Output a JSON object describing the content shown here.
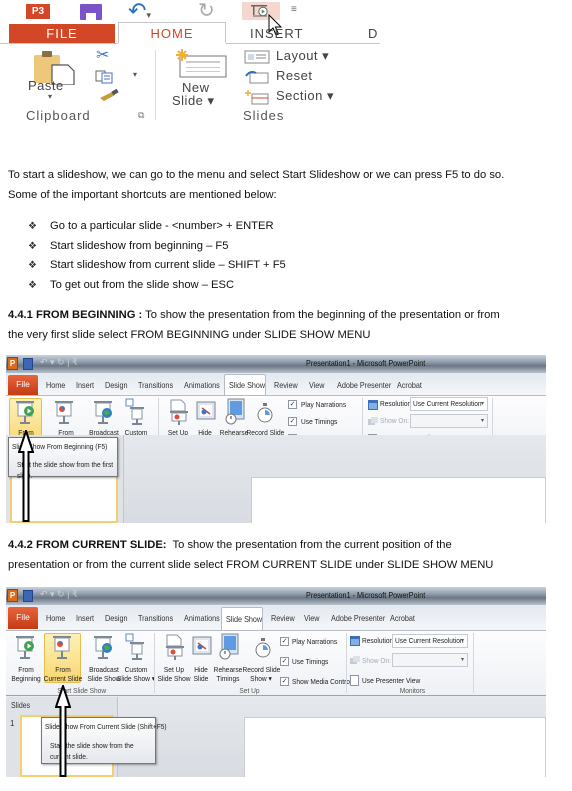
{
  "ribbon2013": {
    "qat": {
      "app_icon": "P3",
      "save_icon": "save-icon",
      "undo_icon": "undo-icon",
      "redo_icon": "redo-icon",
      "start_icon": "start-from-beginning-icon",
      "dropdown": "▾",
      "customize": "₹"
    },
    "tabs": [
      "FILE",
      "HOME",
      "INSERT",
      "D"
    ],
    "clipboard": {
      "paste": "Paste",
      "paste_arrow": "▾",
      "group": "Clipboard",
      "launcher": "⧉"
    },
    "slides": {
      "new_slide_1": "New",
      "new_slide_2": "Slide ▾",
      "layout": "Layout ▾",
      "reset": "Reset",
      "section": "Section ▾",
      "group": "Slides"
    }
  },
  "text": {
    "intro_1": "To start a slideshow, we can go to the menu and select Start Slideshow or we can press F5 to do so.",
    "intro_2": "Some of the important shortcuts are mentioned below:",
    "bullet_glyph": "❖",
    "bullets": [
      "Go to a particular slide - <number> + ENTER",
      "Start slideshow from beginning – F5",
      "Start slideshow from current slide – SHIFT + F5",
      "To get out from the slide show – ESC"
    ],
    "s1_heading": "4.4.1 FROM BEGINNING :",
    "s1_body_1": " To show the presentation from the beginning of the presentation or from",
    "s1_body_2": "the very first slide select  FROM BEGINNING  under SLIDE SHOW MENU",
    "s2_heading": "4.4.2 FROM CURRENT SLIDE:",
    "s2_body_1": "  To show the presentation from the current position of the",
    "s2_body_2": "presentation or from the current  slide select  FROM CURRENT SLIDE  under SLIDE SHOW MENU"
  },
  "ppt2010": {
    "title": "Presentation1 - Microsoft PowerPoint",
    "app_icon": "P",
    "tabs": [
      "File",
      "Home",
      "Insert",
      "Design",
      "Transitions",
      "Animations",
      "Slide Show",
      "Review",
      "View",
      "Adobe Presenter",
      "Acrobat"
    ],
    "active_tab": "Slide Show",
    "start_group": {
      "label": "Start Slide Show",
      "buttons": [
        {
          "l1": "From",
          "l2": "Beginning"
        },
        {
          "l1": "From",
          "l2": "Current Slide"
        },
        {
          "l1": "Broadcast",
          "l2": "Slide Show"
        },
        {
          "l1": "Custom",
          "l2": "Slide Show ▾"
        }
      ]
    },
    "setup_group": {
      "label": "Set Up",
      "buttons": [
        {
          "l1": "Set Up",
          "l2": "Slide Show"
        },
        {
          "l1": "Hide",
          "l2": "Slide"
        },
        {
          "l1": "Rehearse",
          "l2": "Timings"
        },
        {
          "l1": "Record Slide",
          "l2": "Show ▾"
        }
      ],
      "checks": [
        {
          "label": "Play Narrations",
          "checked": true
        },
        {
          "label": "Use Timings",
          "checked": true
        },
        {
          "label": "Show Media Controls",
          "checked": true
        }
      ]
    },
    "monitors_group": {
      "label": "Monitors",
      "resolution_label": "Resolution:",
      "resolution_value": "Use Current Resolution",
      "show_on_label": "Show On:",
      "show_on_value": "",
      "presenter_view": "Use Presenter View",
      "presenter_view_checked": false
    },
    "check_glyph": "✓",
    "dd_glyph": "▾"
  },
  "shot1": {
    "highlighted": "From Beginning",
    "tooltip_title": "Slide Show From Beginning (F5)",
    "tooltip_desc": "Start the slide show from the first slide."
  },
  "shot2": {
    "highlighted": "From Current Slide",
    "slides_pane_label": "Slides",
    "slide_number": "1",
    "tooltip_title": "Slide Show From Current Slide (Shift+F5)",
    "tooltip_desc": "Start the slide show from the current slide."
  }
}
